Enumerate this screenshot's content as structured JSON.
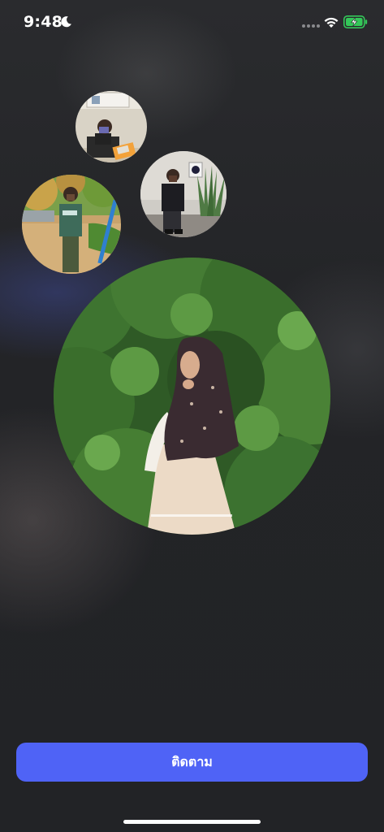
{
  "status_bar": {
    "time": "9:48",
    "focus_icon": "moon-icon",
    "signal_icon": "signal-dots-icon",
    "wifi_icon": "wifi-icon",
    "battery_icon": "battery-charging-icon",
    "battery_color": "#34c759"
  },
  "avatars": [
    {
      "icon": "profile-photo-man-reading"
    },
    {
      "icon": "profile-photo-man-standing-indoors"
    },
    {
      "icon": "profile-photo-man-outdoors"
    },
    {
      "icon": "profile-photo-woman-hijab-garden"
    }
  ],
  "follow_button": {
    "label": "ติดตาม",
    "color": "#4f63f6"
  }
}
